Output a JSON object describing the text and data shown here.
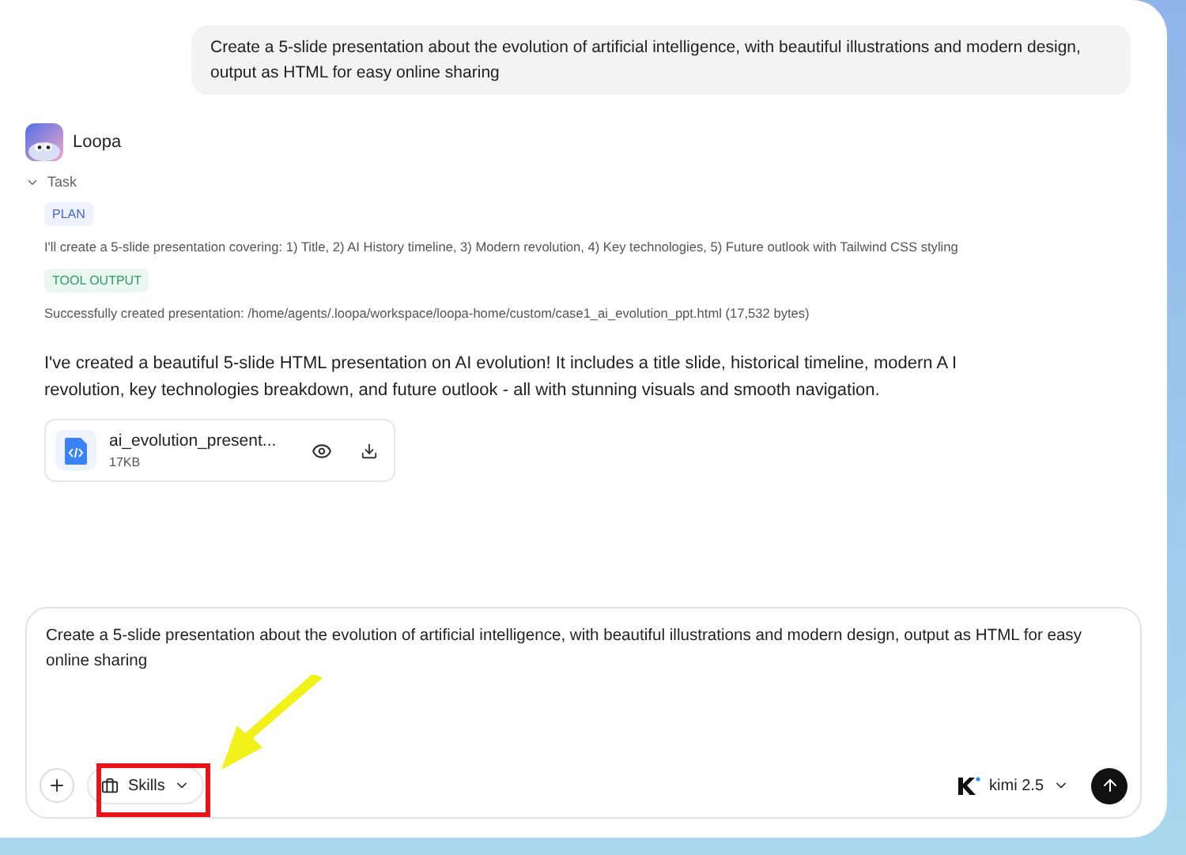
{
  "user_message": "Create a 5-slide presentation about the evolution of artificial intelligence, with beautiful illustrations and modern design, output as HTML for easy online sharing",
  "assistant": {
    "name": "Loopa",
    "task": {
      "label": "Task",
      "expanded": true,
      "steps": [
        {
          "kind": "plan",
          "badge": "PLAN",
          "text": "I'll create a 5-slide presentation covering: 1) Title, 2) AI History timeline, 3) Modern revolution, 4) Key technologies, 5) Future outlook with Tailwind CSS styling"
        },
        {
          "kind": "tool",
          "badge": "TOOL OUTPUT",
          "text": "Successfully created presentation: /home/agents/.loopa/workspace/loopa-home/custom/case1_ai_evolution_ppt.html (17,532 bytes)"
        }
      ]
    },
    "reply": "I've created a beautiful 5-slide HTML presentation on AI evolution! It includes a title slide, historical timeline, modern A I revolution, key technologies breakdown, and future outlook - all with stunning visuals and smooth navigation.",
    "file": {
      "name": "ai_evolution_present...",
      "size": "17KB"
    }
  },
  "composer": {
    "value": "Create a 5-slide presentation about the evolution of artificial intelligence, with beautiful illustrations and modern design, output as HTML for easy online sharing",
    "skills_label": "Skills",
    "model": "kimi 2.5"
  }
}
